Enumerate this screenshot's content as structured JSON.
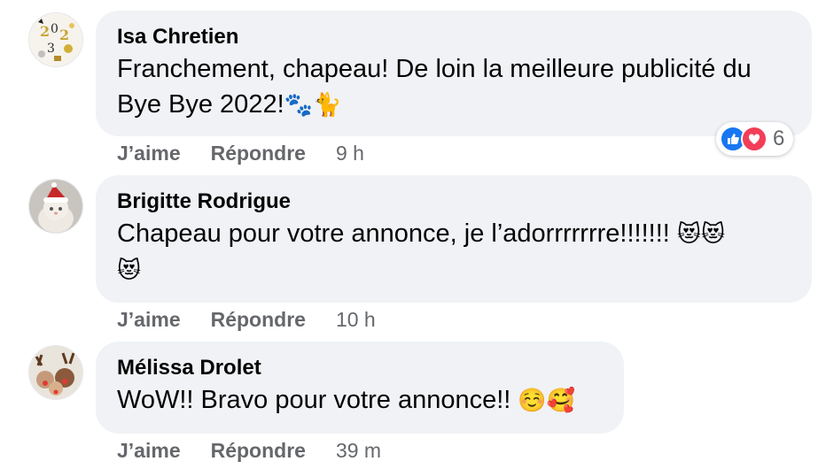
{
  "comments": [
    {
      "author": "Isa Chretien",
      "text_line1": "Franchement, chapeau! De loin la meilleure publicité du",
      "text_line2": "Bye Bye 2022!",
      "text_emoji": "🐾🐈",
      "actions": {
        "like": "J’aime",
        "reply": "Répondre",
        "time": "9 h"
      },
      "reactions": {
        "icons": [
          "like-icon",
          "love-icon"
        ],
        "count": "6",
        "like_color": "#1877f2",
        "love_color": "#f33e58"
      }
    },
    {
      "author": "Brigitte Rodrigue",
      "text_line1": "Chapeau pour votre annonce, je l’adorrrrrrre!!!!!!!",
      "text_emoji1": "😻😻",
      "text_emoji2": "😻",
      "actions": {
        "like": "J’aime",
        "reply": "Répondre",
        "time": "10 h"
      }
    },
    {
      "author": "Mélissa Drolet",
      "text_line1": "WoW!! Bravo pour votre annonce!!",
      "text_emoji": "☺️🥰",
      "actions": {
        "like": "J’aime",
        "reply": "Répondre",
        "time": "39 m"
      }
    }
  ]
}
